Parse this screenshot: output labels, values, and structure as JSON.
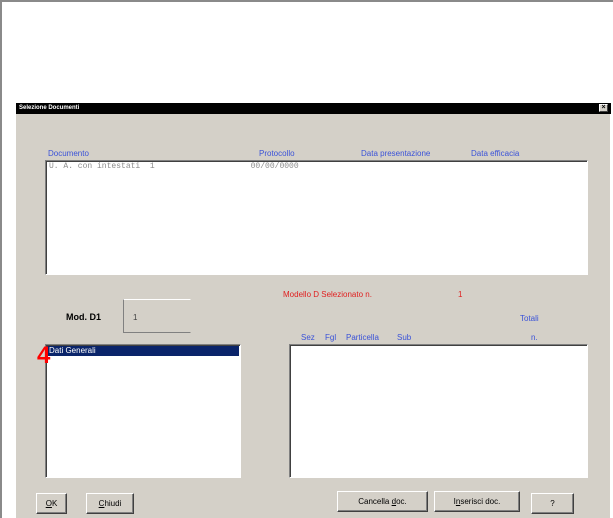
{
  "window": {
    "title": "Selezione Documenti",
    "close_glyph": "×"
  },
  "documents": {
    "headers": {
      "documento": "Documento",
      "protocollo": "Protocollo",
      "data_presentazione": "Data presentazione",
      "data_efficacia": "Data efficacia"
    },
    "rows": [
      {
        "text": "U. A. con intestati  1                    00/00/0000"
      }
    ]
  },
  "modello": {
    "label": "Modello D Selezionato n.",
    "value": "1"
  },
  "mod": {
    "label": "Mod. D1",
    "value": "1"
  },
  "right_list": {
    "totali": "Totali",
    "sez": "Sez",
    "fgl": "Fgl",
    "particella": "Particella",
    "sub": "Sub",
    "n": "n."
  },
  "left_list": {
    "items": [
      "Dati Generali"
    ]
  },
  "step_number": "4",
  "buttons": {
    "ok": {
      "mnemonic": "O",
      "rest": "K"
    },
    "chiudi": {
      "mnemonic": "C",
      "rest": "hiudi"
    },
    "cancella": {
      "pre": "Cancella ",
      "mnemonic": "d",
      "rest": "oc."
    },
    "inserisci": {
      "pre": "I",
      "mnemonic": "n",
      "rest": "serisci doc."
    },
    "help": "?"
  },
  "colors": {
    "header_blue": "#3a52d8",
    "highlight_red": "#e02020",
    "selection": "#0a246a",
    "dialog_gray": "#d4d0c8"
  }
}
